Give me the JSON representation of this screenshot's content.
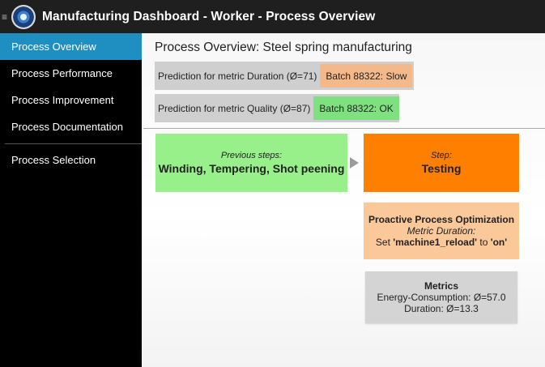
{
  "header": {
    "menu_glyph": "≡",
    "app_title": "Manufacturing Dashboard - Worker - Process Overview"
  },
  "sidebar": {
    "items": [
      {
        "label": "Process Overview",
        "active": true
      },
      {
        "label": "Process Performance",
        "active": false
      },
      {
        "label": "Process Improvement",
        "active": false
      },
      {
        "label": "Process Documentation",
        "active": false
      }
    ],
    "secondary_items": [
      {
        "label": "Process Selection",
        "active": false
      }
    ]
  },
  "main": {
    "title": "Process Overview: Steel spring manufacturing",
    "predictions": [
      {
        "label": "Prediction for metric Duration (Ø=71)",
        "value": "Batch 88322: Slow",
        "color": "#f4b98a"
      },
      {
        "label": "Prediction for metric Quality (Ø=87)",
        "value": "Batch 88322: OK",
        "color": "#7ee07e"
      }
    ],
    "previous_steps": {
      "title": "Previous steps:",
      "steps": "Winding, Tempering, Shot peening",
      "color": "#98f08a"
    },
    "current_step": {
      "title": "Step:",
      "name": "Testing",
      "color": "#ff7f00"
    },
    "optimization": {
      "title": "Proactive Process Optimization",
      "metric": "Metric Duration:",
      "action_prefix": "Set ",
      "setting": "'machine1_reload'",
      "action_mid": " to ",
      "setting_value": "'on'",
      "color": "#fbc89a"
    },
    "metrics": {
      "title": "Metrics",
      "lines": [
        "Energy-Consumption: Ø=57.0",
        "Duration: Ø=13.3"
      ]
    }
  },
  "colors": {
    "header_bg": "#1f1f1f",
    "sidebar_bg": "#000000",
    "sidebar_active": "#1f8fc1"
  }
}
